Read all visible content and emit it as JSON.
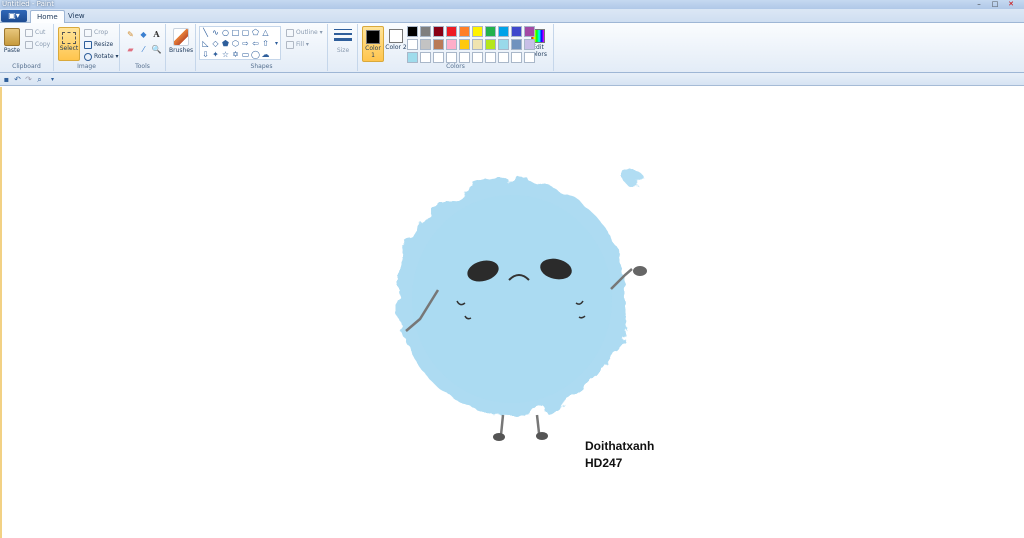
{
  "window": {
    "title": "Untitled - Paint",
    "minimize": "–",
    "maximize": "□",
    "close": "✕"
  },
  "tabs": [
    {
      "label": "Home"
    },
    {
      "label": "View"
    }
  ],
  "app_menu_icon": "▣▾",
  "ribbon": {
    "clipboard": {
      "label": "Clipboard",
      "paste": "Paste",
      "cut": "Cut",
      "copy": "Copy"
    },
    "image": {
      "label": "Image",
      "select": "Select",
      "crop": "Crop",
      "resize": "Resize",
      "rotate": "Rotate ▾"
    },
    "tools": {
      "label": "Tools",
      "text_tool_glyph": "A"
    },
    "brushes": {
      "label": "Brushes"
    },
    "shapes": {
      "label": "Shapes",
      "outline": "Outline ▾",
      "fill": "Fill ▾"
    },
    "size": {
      "label": "Size"
    },
    "colors": {
      "label": "Colors",
      "color1": "Color 1",
      "color2": "Color 2",
      "edit": "Edit colors",
      "color1_value": "#000000",
      "color2_value": "#ffffff",
      "palette": [
        "#000000",
        "#7f7f7f",
        "#880015",
        "#ed1c24",
        "#ff7f27",
        "#fff200",
        "#22b14c",
        "#00a2e8",
        "#3f48cc",
        "#a349a4",
        "#ffffff",
        "#c3c3c3",
        "#b97a57",
        "#ffaec9",
        "#ffc90e",
        "#efe4b0",
        "#b5e61d",
        "#99d9ea",
        "#7092be",
        "#c8bfe7",
        "#9fdcec",
        "#ffffff",
        "#ffffff",
        "#ffffff",
        "#ffffff",
        "#ffffff",
        "#ffffff",
        "#ffffff",
        "#ffffff",
        "#ffffff"
      ]
    }
  },
  "canvas": {
    "text_line1": "Doithatxanh",
    "text_line2": "HD247",
    "blob_color": "#a9daf2"
  }
}
